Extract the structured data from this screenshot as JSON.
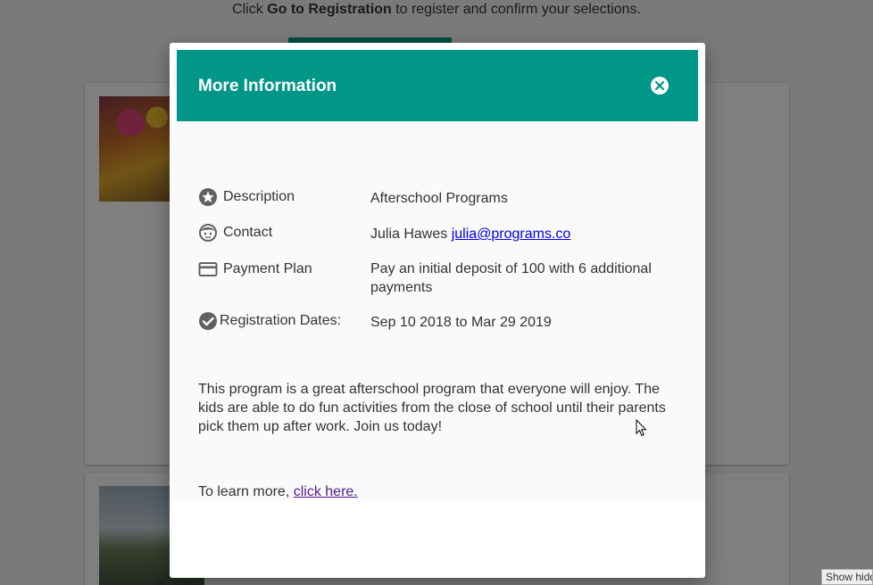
{
  "background": {
    "instruction_prefix": "Click ",
    "instruction_bold": "Go to Registration",
    "instruction_suffix": " to register and confirm your selections."
  },
  "show_hidden_label": "Show hidd",
  "modal": {
    "title": "More Information",
    "rows": [
      {
        "icon": "star-icon",
        "label": "Description",
        "value": "Afterschool Programs"
      },
      {
        "icon": "face-icon",
        "label": "Contact",
        "value": "Julia Hawes ",
        "link": "julia@programs.co"
      },
      {
        "icon": "credit-card-icon",
        "label": "Payment Plan",
        "value": "Pay an initial deposit of 100 with 6 additional payments"
      },
      {
        "icon": "check-circle-icon",
        "label": "Registration Dates:",
        "value": "Sep 10 2018 to Mar 29 2019"
      }
    ],
    "description": "This program is a great afterschool program that everyone will enjoy. The kids are able to do fun activities from the close of school until their parents pick them up after work. Join us today!",
    "learn_more_prefix": "To learn more, ",
    "learn_more_link": "click here. "
  },
  "colors": {
    "accent": "#009688",
    "link": "#0000ee",
    "visited_link": "#551a8b"
  }
}
